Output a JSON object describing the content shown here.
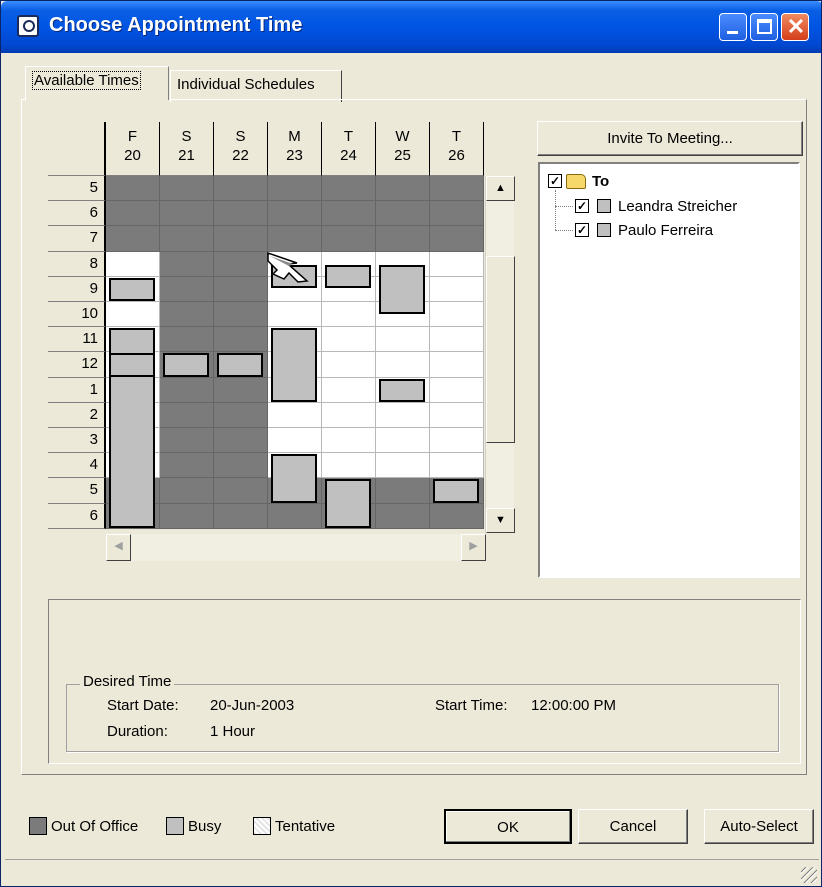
{
  "window": {
    "title": "Choose Appointment Time",
    "icon": "clock-icon",
    "controls": [
      "minimize-icon",
      "maximize-icon",
      "close-icon"
    ]
  },
  "tabs": [
    {
      "label": "Available Times",
      "active": true
    },
    {
      "label": "Individual Schedules",
      "active": false
    }
  ],
  "schedule": {
    "days": [
      {
        "dow": "F",
        "date": "20"
      },
      {
        "dow": "S",
        "date": "21"
      },
      {
        "dow": "S",
        "date": "22"
      },
      {
        "dow": "M",
        "date": "23"
      },
      {
        "dow": "T",
        "date": "24"
      },
      {
        "dow": "W",
        "date": "25"
      },
      {
        "dow": "T",
        "date": "26"
      }
    ],
    "hours": [
      "5",
      "6",
      "7",
      "8",
      "9",
      "10",
      "11",
      "12",
      "1",
      "2",
      "3",
      "4",
      "5",
      "6"
    ],
    "colors": {
      "out_of_office": "#7b7b7b",
      "busy": "#c0c0c0",
      "free": "#ffffff"
    }
  },
  "invite_button": "Invite To Meeting...",
  "attendees": {
    "root_label": "To",
    "root_checked": true,
    "people": [
      {
        "name": "Leandra Streicher",
        "checked": true
      },
      {
        "name": "Paulo Ferreira",
        "checked": true
      }
    ]
  },
  "desired_time": {
    "label": "Desired Time",
    "start_date_label": "Start Date:",
    "start_date": "20-Jun-2003",
    "start_time_label": "Start Time:",
    "start_time": "12:00:00 PM",
    "duration_label": "Duration:",
    "duration": "1 Hour"
  },
  "legend": {
    "out_of_office": "Out Of Office",
    "busy": "Busy",
    "tentative": "Tentative"
  },
  "buttons": {
    "ok": "OK",
    "cancel": "Cancel",
    "auto_select": "Auto-Select"
  },
  "checkmark": "✓"
}
